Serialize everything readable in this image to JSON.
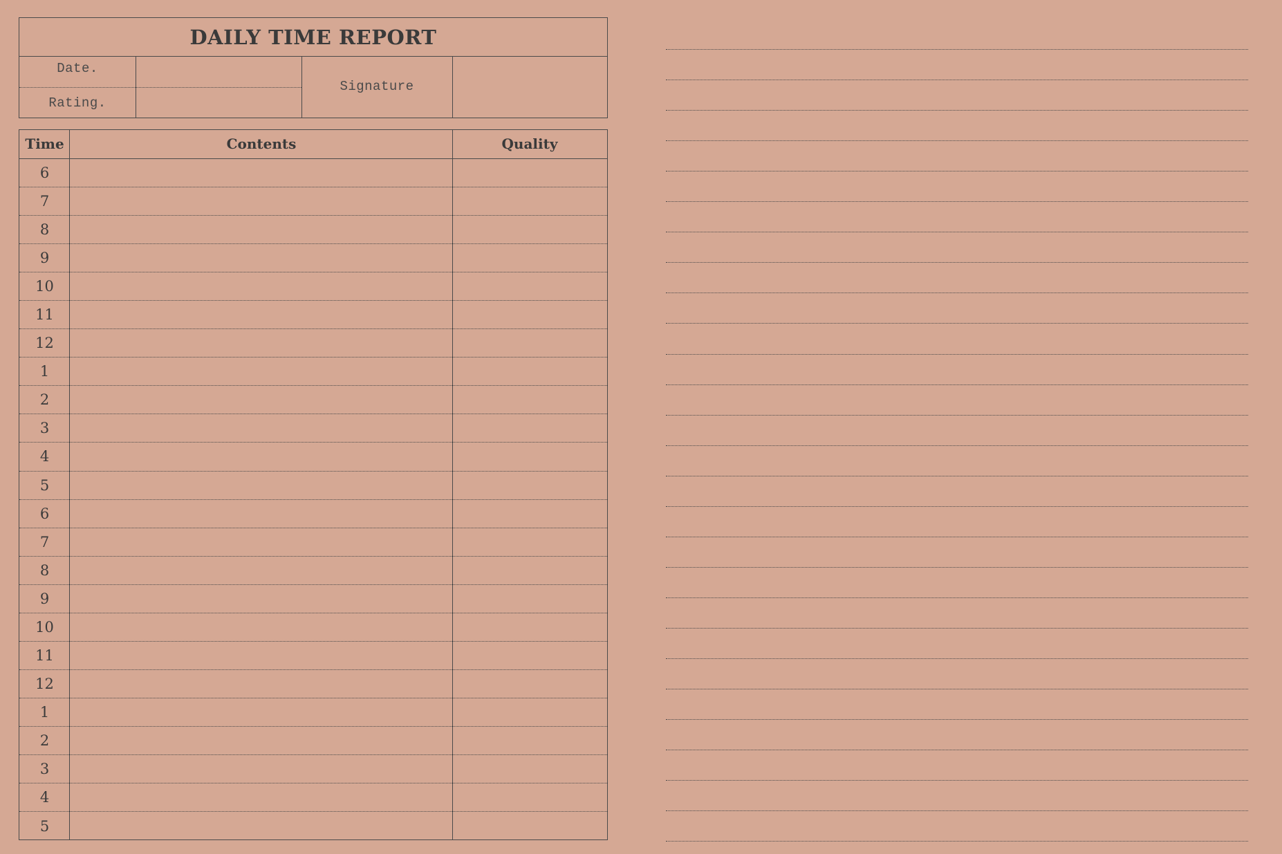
{
  "report": {
    "title": "DAILY TIME REPORT",
    "date_label": "Date.",
    "rating_label": "Rating.",
    "signature_label": "Signature"
  },
  "table": {
    "headers": {
      "time": "Time",
      "contents": "Contents",
      "quality": "Quality"
    },
    "hours": [
      "6",
      "7",
      "8",
      "9",
      "10",
      "11",
      "12",
      "1",
      "2",
      "3",
      "4",
      "5",
      "6",
      "7",
      "8",
      "9",
      "10",
      "11",
      "12",
      "1",
      "2",
      "3",
      "4",
      "5"
    ]
  },
  "notes": {
    "line_count": 27
  },
  "colors": {
    "paper": "#d5a894",
    "ink": "#3a3a3a"
  }
}
